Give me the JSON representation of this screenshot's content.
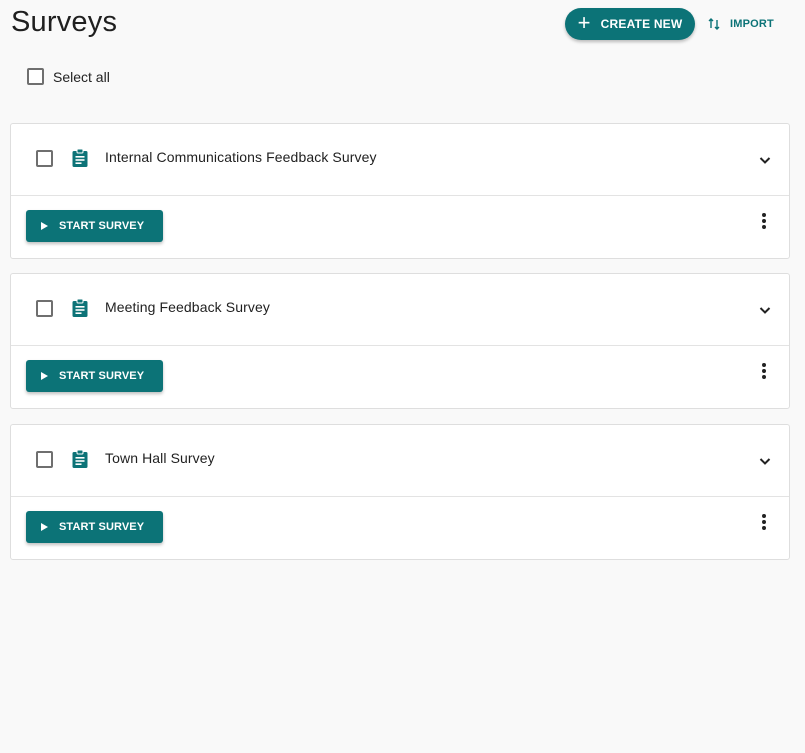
{
  "header": {
    "title": "Surveys",
    "create_label": "CREATE NEW",
    "import_label": "IMPORT"
  },
  "select_all_label": "Select all",
  "surveys": [
    {
      "title": "Internal Communications Feedback Survey",
      "start_label": "START SURVEY"
    },
    {
      "title": "Meeting Feedback Survey",
      "start_label": "START SURVEY"
    },
    {
      "title": "Town Hall Survey",
      "start_label": "START SURVEY"
    }
  ],
  "icons": {
    "create": "plus-icon",
    "import": "import-arrows-icon",
    "survey": "clipboard-icon",
    "expand": "chevron-down-icon",
    "start": "play-icon",
    "more": "more-vertical-icon"
  },
  "colors": {
    "accent": "#0c7377",
    "background": "#f9f9f9"
  }
}
